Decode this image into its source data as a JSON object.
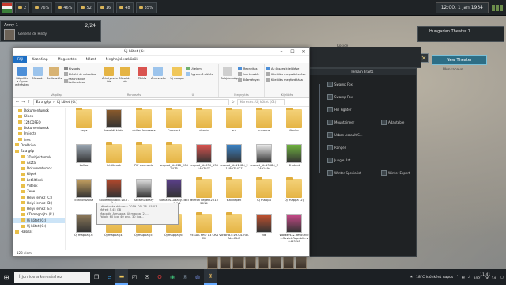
{
  "game": {
    "topbar": {
      "values": [
        "2",
        "76%",
        "46%",
        "52",
        "16",
        "48",
        "35%"
      ],
      "date": "12:00, 1 Jan 1934"
    },
    "army": {
      "title": "Army 1",
      "count": "2/24",
      "general": "General Ide Hindy"
    },
    "theater": {
      "title": "Hungarian Theater 1"
    },
    "new_theater": "New Theater",
    "terrain_panel": {
      "header": "Terrain Traits",
      "traits": [
        "Swamp Fox",
        "Swamp Fox",
        "Hill Fighter",
        "Mountaineer",
        "Adaptable",
        "Urban Assault S...",
        "Ranger",
        "Jungle Rat",
        "Winter Specialist",
        "Winter Expert"
      ]
    },
    "map_labels": [
      "Košice",
      "Ungvár",
      "Munkacevo"
    ]
  },
  "explorer": {
    "title": "Új kötet (G:)",
    "tabs": [
      "Fájl",
      "Kezdőlap",
      "Megosztás",
      "Nézet",
      "Meghajtóeszközök"
    ],
    "ribbon": {
      "clipboard": {
        "caption": "Vágólap",
        "pin": "Rögzítés a Gyors elérésben",
        "copy": "Másolás",
        "paste": "Beillesztés",
        "cut": "Kivágás",
        "copy_path": "Elérési út másolása",
        "paste_shortcut": "Parancsikon beillesztése"
      },
      "organize": {
        "caption": "Rendezés",
        "move": "Áthelyezés ide",
        "copy_to": "Másolás ide",
        "delete": "Törlés",
        "rename": "Átnevezés"
      },
      "new": {
        "caption": "Új",
        "new_folder": "Új mappa",
        "new_item": "Új elem",
        "easy_access": "Egyszerű elérés"
      },
      "open": {
        "caption": "Megnyitás",
        "properties": "Tulajdonságok",
        "open": "Megnyitás",
        "edit": "Szerkesztés",
        "history": "Előzmények"
      },
      "select": {
        "caption": "Kijelölés",
        "all": "Az összes kijelölése",
        "none": "Kijelölés megszüntetése",
        "invert": "Kijelölés megfordítása"
      }
    },
    "address": {
      "path": [
        "Ez a gép",
        "Új kötet (G:)"
      ],
      "search_placeholder": "Keresés: Új kötet (G:)"
    },
    "nav_items": [
      {
        "label": "Dokumentumok",
        "selected": false
      },
      {
        "label": "Képek",
        "selected": false
      },
      {
        "label": "124CDPEO",
        "selected": false
      },
      {
        "label": "Dokumentumok",
        "selected": false
      },
      {
        "label": "Projects",
        "selected": false
      },
      {
        "label": "üres",
        "selected": false
      },
      {
        "label": "OneDrive",
        "selected": false
      },
      {
        "label": "Ez a gép",
        "selected": false
      },
      {
        "label": "3D objektumok",
        "selected": false
      },
      {
        "label": "Asztal",
        "selected": false
      },
      {
        "label": "Dokumentumok",
        "selected": false
      },
      {
        "label": "Képek",
        "selected": false
      },
      {
        "label": "Letöltések",
        "selected": false
      },
      {
        "label": "Videók",
        "selected": false
      },
      {
        "label": "Zene",
        "selected": false
      },
      {
        "label": "Helyi lemez (C:)",
        "selected": false
      },
      {
        "label": "Helyi lemez (D:)",
        "selected": false
      },
      {
        "label": "Helyi lemez (E:)",
        "selected": false
      },
      {
        "label": "CD-meghajtó (F:)",
        "selected": false
      },
      {
        "label": "Új kötet (G:)",
        "selected": true
      },
      {
        "label": "Új kötet (G:)",
        "selected": false
      },
      {
        "label": "Hálózat",
        "selected": false
      }
    ],
    "files": [
      [
        "anya",
        "bezaldi kirdo",
        "cirilas fotozema",
        "Crossout",
        "dando",
        "eut",
        "eukaeve",
        "fiduko"
      ],
      [
        "kollaa",
        "letöltesek",
        "PiP vieerablo",
        "scoped_dir028_2042473",
        "scoped_dir036_1341407973",
        "scoped_dir11084_2118075427",
        "scoped_dir13684_97491494",
        "Shotcut"
      ],
      [
        "convofozaka",
        "SovietRepublic.v0.7.3.5",
        "SteamLibrary",
        "Stellaris.Galaxy.Edition.v1.6.1",
        "telefon képek 2013 2014",
        "túti képek",
        "Új mappa",
        "Új mappa (2)"
      ],
      [
        "Új mappa (3)",
        "Új mappa (4)",
        "Új mappa (5)",
        "Új mappa (6)",
        "VEGAS PRO 18 CRACK",
        "Victoria.II.v3.04.incl.ALL.DLC",
        "vidi",
        "Workers.&.Resources.Soviet.Republic.v0.8.3.10"
      ]
    ],
    "status": "128 elem",
    "tooltip": [
      "Létrehozás dátuma: 2019. 05. 28. 15:03",
      "Méret: 5,45 GB",
      "Mappák: Almappa, Új mappa (2)...",
      "Fájlok: 60 jpg, 40 png, 30 jpg..."
    ]
  },
  "taskbar": {
    "search_placeholder": "Írjon ide a kereséshez",
    "weather": "18°C  Időnként napos",
    "time": "11:41",
    "date": "2021. 06. 14."
  }
}
